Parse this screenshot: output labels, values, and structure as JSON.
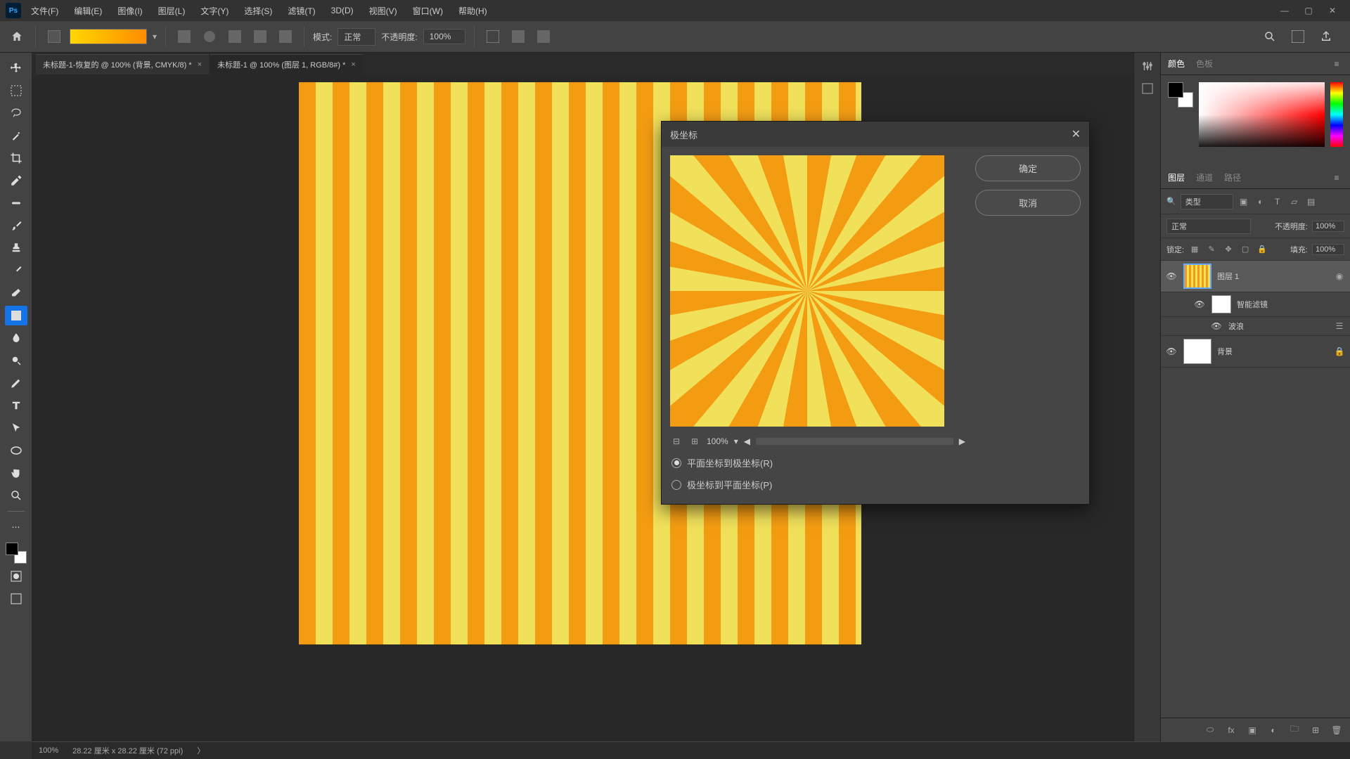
{
  "app": {
    "logo": "Ps"
  },
  "menu": [
    "文件(F)",
    "编辑(E)",
    "图像(I)",
    "图层(L)",
    "文字(Y)",
    "选择(S)",
    "滤镜(T)",
    "3D(D)",
    "视图(V)",
    "窗口(W)",
    "帮助(H)"
  ],
  "optionsBar": {
    "modeLabel": "模式:",
    "modeValue": "正常",
    "opacityLabel": "不透明度:",
    "opacityValue": "100%"
  },
  "tabs": [
    {
      "label": "未标题-1-恢复的 @ 100% (背景, CMYK/8) *"
    },
    {
      "label": "未标题-1 @ 100% (图层 1, RGB/8#) *"
    }
  ],
  "dialog": {
    "title": "极坐标",
    "ok": "确定",
    "cancel": "取消",
    "zoom": "100%",
    "option1": "平面坐标到极坐标(R)",
    "option2": "极坐标到平面坐标(P)"
  },
  "panels": {
    "colorTabs": [
      "颜色",
      "色板"
    ],
    "layerTabs": [
      "图层",
      "通道",
      "路径"
    ],
    "filterLabel": "类型",
    "blendLabel": "正常",
    "opacityLabel": "不透明度:",
    "opacityValue": "100%",
    "lockLabel": "锁定:",
    "fillLabel": "填充:",
    "fillValue": "100%",
    "layers": {
      "0": {
        "name": "图层 1"
      },
      "1": {
        "name": "智能滤镜"
      },
      "2": {
        "name": "波浪"
      },
      "3": {
        "name": "背景"
      }
    }
  },
  "status": {
    "zoom": "100%",
    "dims": "28.22 厘米 x 28.22 厘米 (72 ppi)"
  }
}
